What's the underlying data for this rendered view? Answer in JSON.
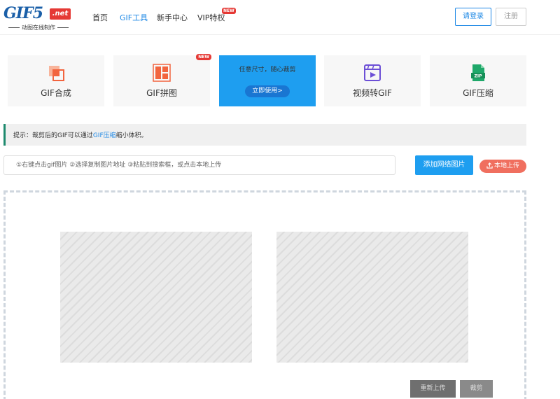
{
  "header": {
    "logo_main": "GIF5",
    "logo_net": ".net",
    "logo_sub": "动图在线制作",
    "nav": [
      {
        "label": "首页"
      },
      {
        "label": "GIF工具"
      },
      {
        "label": "新手中心"
      },
      {
        "label": "VIP特权",
        "badge": "NEW"
      }
    ],
    "login_label": "请登录",
    "register_label": "注册",
    "accent_color": "#1e88e5"
  },
  "tools": [
    {
      "label": "GIF合成",
      "icon": "gif-merge-icon"
    },
    {
      "label": "GIF拼图",
      "icon": "gif-collage-icon",
      "badge": "NEW"
    },
    {
      "hint": "任意尺寸，随心裁剪",
      "button": "立即使用>",
      "active": true
    },
    {
      "label": "视频转GIF",
      "icon": "video-to-gif-icon"
    },
    {
      "label": "GIF压缩",
      "icon": "zip-icon"
    }
  ],
  "tip": {
    "prefix": "提示：裁剪后的GIF可以通过",
    "link": "GIF压缩",
    "suffix": "缩小体积。"
  },
  "upload": {
    "placeholder": "①右键点击gif图片 ②选择复制图片地址 ③粘贴到搜索框，或点击本地上传",
    "add_label": "添加网络图片",
    "local_label": "本地上传"
  },
  "actions": {
    "reupload_label": "重新上传",
    "crop_label": "裁剪"
  }
}
